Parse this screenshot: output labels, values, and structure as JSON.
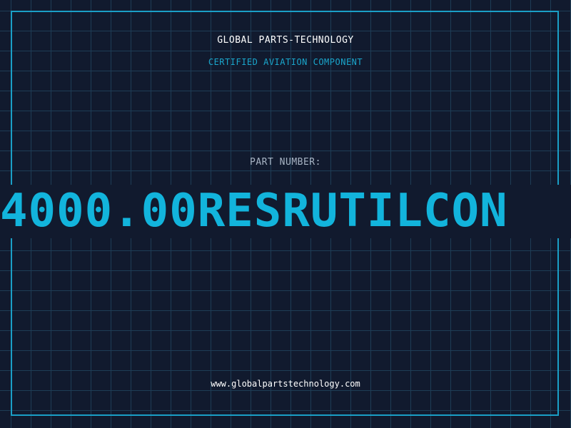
{
  "header": {
    "company_name": "GLOBAL PARTS-TECHNOLOGY",
    "tagline": "CERTIFIED AVIATION COMPONENT"
  },
  "part": {
    "label": "PART NUMBER:",
    "number": "4000.00RESRUTILCON"
  },
  "footer": {
    "website": "www.globalpartstechnology.com"
  },
  "colors": {
    "background": "#111a2e",
    "grid": "#1e3d56",
    "accent": "#12b4dc",
    "frame": "#1a9fc6"
  }
}
